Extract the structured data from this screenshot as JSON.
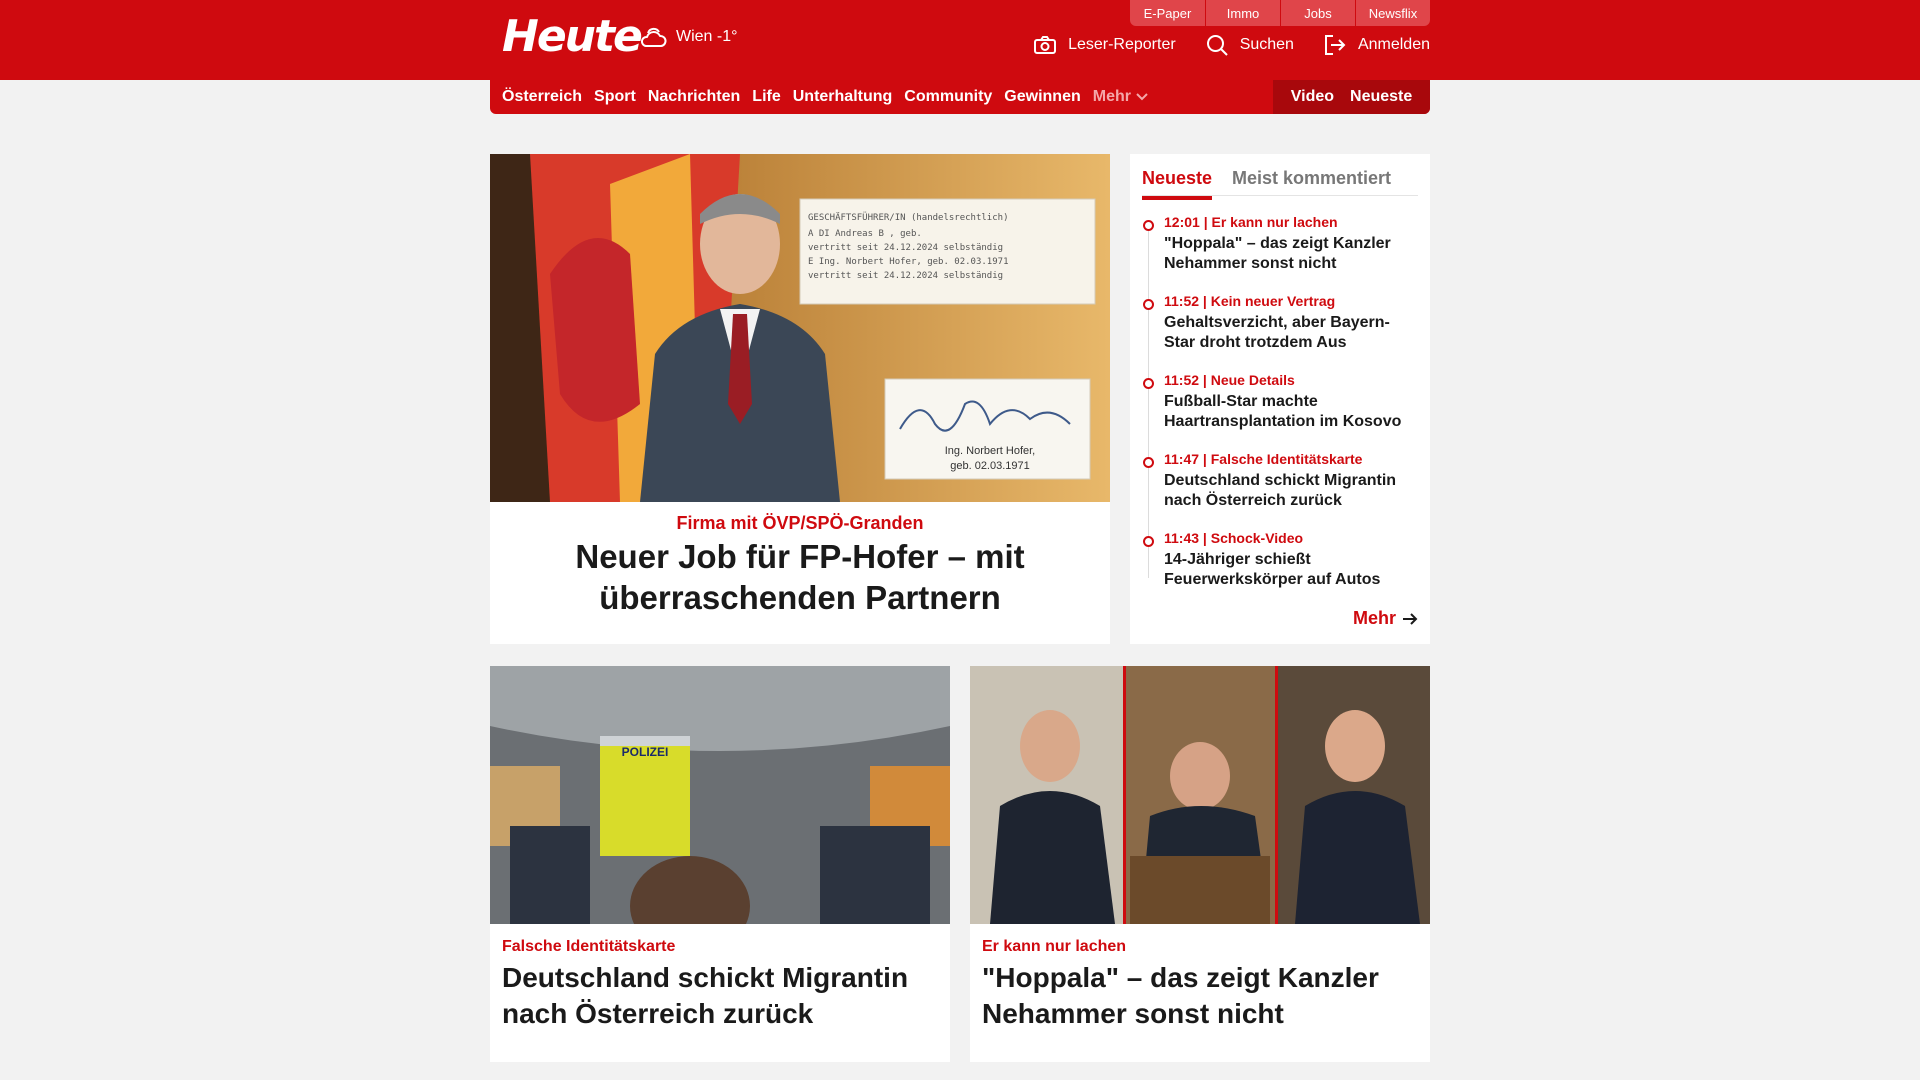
{
  "header": {
    "logo": "Heute",
    "weather": "Wien -1°",
    "top_tabs": [
      "E-Paper",
      "Immo",
      "Jobs",
      "Newsflix"
    ],
    "actions": {
      "leser_reporter": "Leser-Reporter",
      "search": "Suchen",
      "login": "Anmelden"
    }
  },
  "nav": {
    "items": [
      "Österreich",
      "Sport",
      "Nachrichten",
      "Life",
      "Unterhaltung",
      "Community",
      "Gewinnen"
    ],
    "more": "Mehr",
    "video": "Video",
    "newest": "Neueste"
  },
  "hero": {
    "kicker": "Firma mit ÖVP/SPÖ-Granden",
    "title": "Neuer Job für FP-Hofer – mit überraschenden Partnern",
    "doc_lines": [
      "GESCHÄFTSFÜHRER/IN (handelsrechtlich)",
      "A   DI Andreas B       , geb.",
      "    vertritt seit 24.12.2024 selbständig",
      "E   Ing. Norbert Hofer, geb. 02.03.1971",
      "    vertritt seit 24.12.2024 selbständig"
    ],
    "signature_caption_1": "Ing. Norbert Hofer,",
    "signature_caption_2": "geb. 02.03.1971"
  },
  "sidebar": {
    "tab_active": "Neueste",
    "tab_other": "Meist kommentiert",
    "items": [
      {
        "meta": "12:01 | Er kann nur lachen",
        "title": "\"Hoppala\" – das zeigt Kanzler Nehammer sonst nicht"
      },
      {
        "meta": "11:52 | Kein neuer Vertrag",
        "title": "Gehaltsverzicht, aber Bayern-Star droht trotzdem Aus"
      },
      {
        "meta": "11:52 | Neue Details",
        "title": "Fußball-Star machte Haartransplantation im Kosovo"
      },
      {
        "meta": "11:47 | Falsche Identitätskarte",
        "title": "Deutschland schickt Migrantin nach Österreich zurück"
      },
      {
        "meta": "11:43 | Schock-Video",
        "title": "14-Jähriger schießt Feuerwerkskörper auf Autos"
      }
    ],
    "more": "Mehr"
  },
  "cards": [
    {
      "kicker": "Falsche Identitätskarte",
      "title": "Deutschland schickt Migrantin nach Österreich zurück",
      "vest_text": "POLIZEI"
    },
    {
      "kicker": "Er kann nur lachen",
      "title": "\"Hoppala\" – das zeigt Kanzler Nehammer sonst nicht"
    }
  ],
  "colors": {
    "brand_red": "#cf0a0f",
    "dark_red": "#a8080c",
    "page_bg": "#f2f2f2"
  }
}
